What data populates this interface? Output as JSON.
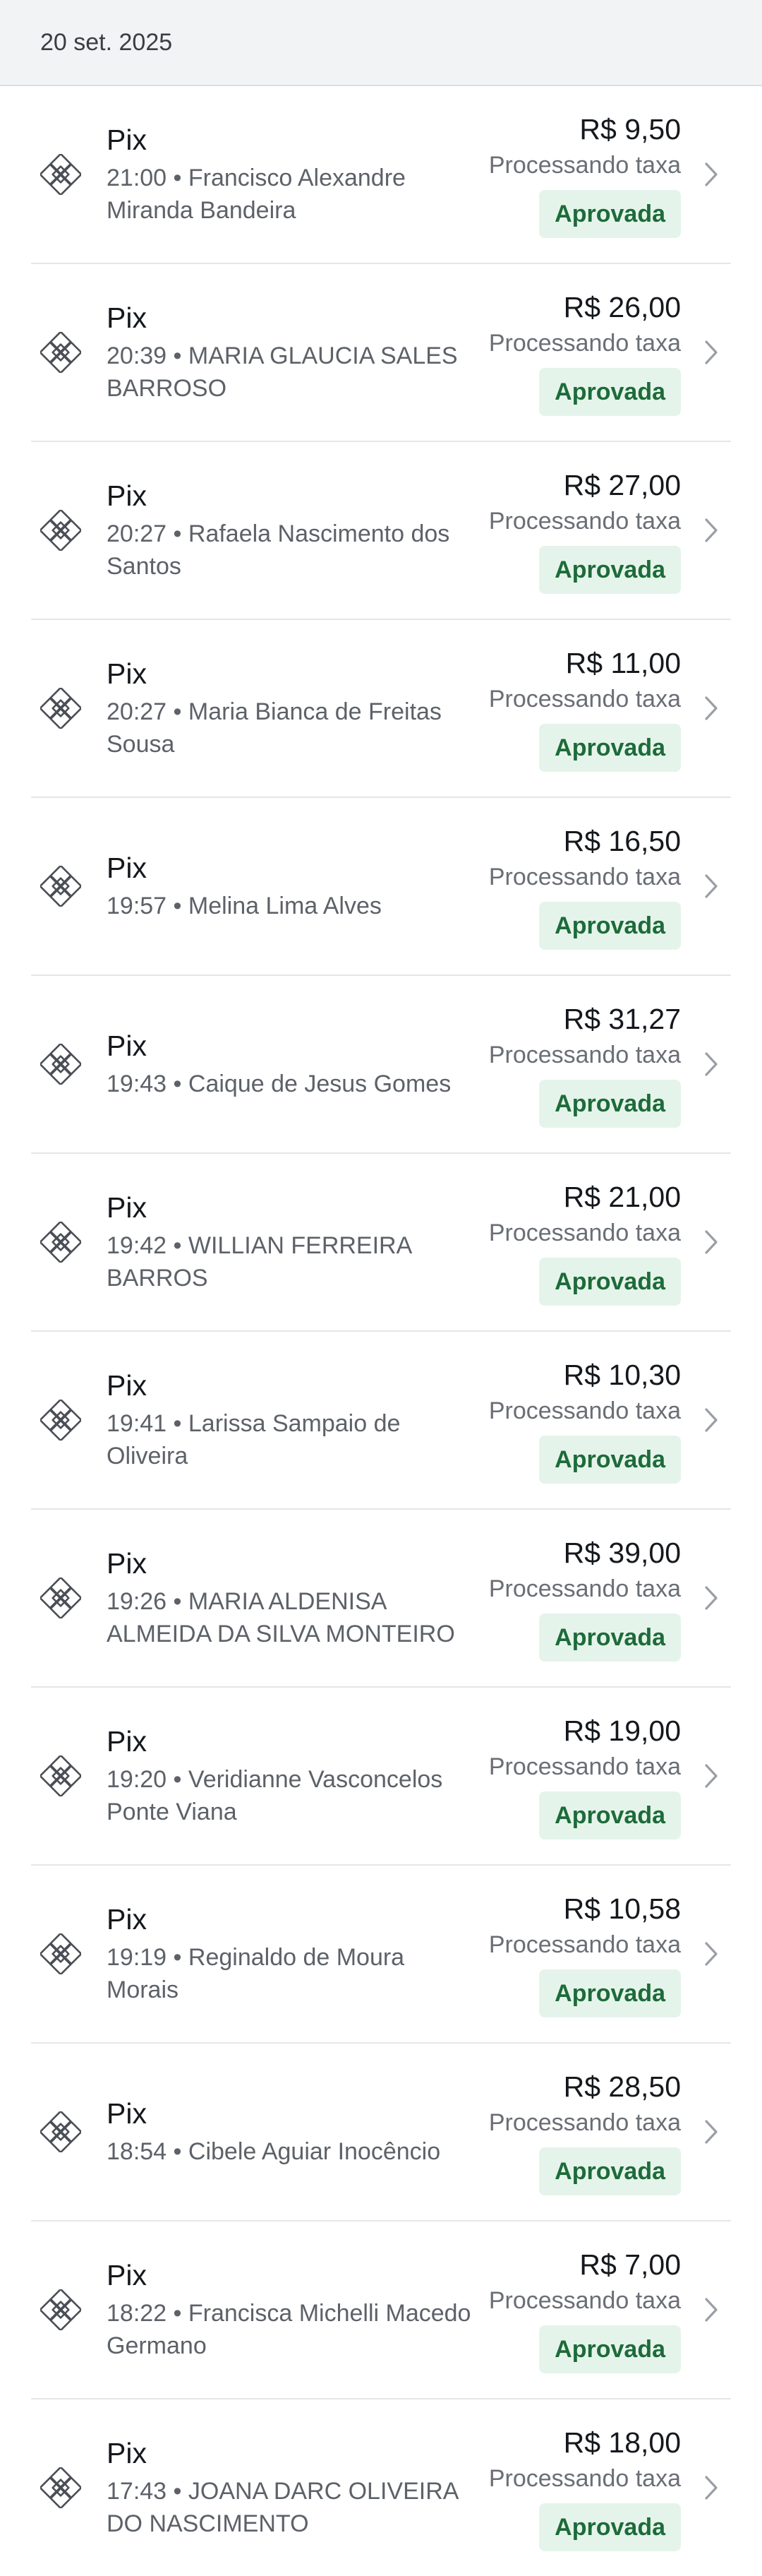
{
  "header": {
    "date": "20 set. 2025"
  },
  "icons": {
    "payment": "pix-icon",
    "chevron": "chevron-right-icon"
  },
  "colors": {
    "badge_bg": "#e5f4ea",
    "badge_text": "#1d6b3a",
    "header_bg": "#f2f3f4"
  },
  "transactions": [
    {
      "method": "Pix",
      "time": "21:00",
      "name": "Francisco Alexandre Miranda Bandeira",
      "amount": "R$ 9,50",
      "note": "Processando taxa",
      "status": "Aprovada"
    },
    {
      "method": "Pix",
      "time": "20:39",
      "name": "MARIA GLAUCIA SALES BARROSO",
      "amount": "R$ 26,00",
      "note": "Processando taxa",
      "status": "Aprovada"
    },
    {
      "method": "Pix",
      "time": "20:27",
      "name": "Rafaela Nascimento dos Santos",
      "amount": "R$ 27,00",
      "note": "Processando taxa",
      "status": "Aprovada"
    },
    {
      "method": "Pix",
      "time": "20:27",
      "name": "Maria Bianca de Freitas Sousa",
      "amount": "R$ 11,00",
      "note": "Processando taxa",
      "status": "Aprovada"
    },
    {
      "method": "Pix",
      "time": "19:57",
      "name": "Melina Lima Alves",
      "amount": "R$ 16,50",
      "note": "Processando taxa",
      "status": "Aprovada"
    },
    {
      "method": "Pix",
      "time": "19:43",
      "name": "Caique de Jesus Gomes",
      "amount": "R$ 31,27",
      "note": "Processando taxa",
      "status": "Aprovada"
    },
    {
      "method": "Pix",
      "time": "19:42",
      "name": "WILLIAN FERREIRA BARROS",
      "amount": "R$ 21,00",
      "note": "Processando taxa",
      "status": "Aprovada"
    },
    {
      "method": "Pix",
      "time": "19:41",
      "name": "Larissa Sampaio de Oliveira",
      "amount": "R$ 10,30",
      "note": "Processando taxa",
      "status": "Aprovada"
    },
    {
      "method": "Pix",
      "time": "19:26",
      "name": "MARIA ALDENISA ALMEIDA DA SILVA MONTEIRO",
      "amount": "R$ 39,00",
      "note": "Processando taxa",
      "status": "Aprovada"
    },
    {
      "method": "Pix",
      "time": "19:20",
      "name": "Veridianne Vasconcelos Ponte Viana",
      "amount": "R$ 19,00",
      "note": "Processando taxa",
      "status": "Aprovada"
    },
    {
      "method": "Pix",
      "time": "19:19",
      "name": "Reginaldo de Moura Morais",
      "amount": "R$ 10,58",
      "note": "Processando taxa",
      "status": "Aprovada"
    },
    {
      "method": "Pix",
      "time": "18:54",
      "name": "Cibele Aguiar Inocêncio",
      "amount": "R$ 28,50",
      "note": "Processando taxa",
      "status": "Aprovada"
    },
    {
      "method": "Pix",
      "time": "18:22",
      "name": "Francisca Michelli Macedo Germano",
      "amount": "R$ 7,00",
      "note": "Processando taxa",
      "status": "Aprovada"
    },
    {
      "method": "Pix",
      "time": "17:43",
      "name": "JOANA DARC OLIVEIRA DO NASCIMENTO",
      "amount": "R$ 18,00",
      "note": "Processando taxa",
      "status": "Aprovada"
    }
  ]
}
